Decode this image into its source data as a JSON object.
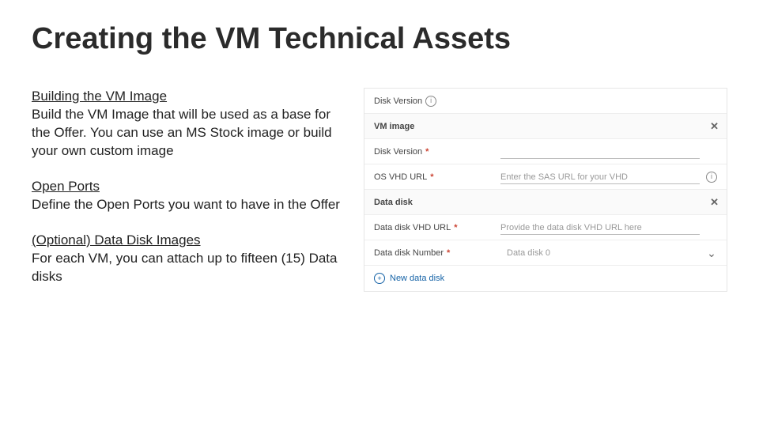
{
  "title": "Creating the VM Technical Assets",
  "sections": [
    {
      "heading": "Building the VM Image",
      "body": "Build the VM Image that will be used as a base for the Offer. You can use an MS Stock image or build your own custom image"
    },
    {
      "heading": "Open Ports",
      "body": "Define the Open Ports you want to have in the Offer"
    },
    {
      "heading": "(Optional) Data Disk Images",
      "body": "For each VM, you can attach up to fifteen (15) Data disks"
    }
  ],
  "form": {
    "row_disk_version_top": "Disk Version",
    "row_vm_image": "VM image",
    "row_disk_version": {
      "label": "Disk Version",
      "required": "*"
    },
    "row_os_vhd": {
      "label": "OS VHD URL",
      "required": "*",
      "placeholder": "Enter the SAS URL for your VHD"
    },
    "row_data_disk_hdr": "Data disk",
    "row_dd_vhd": {
      "label": "Data disk VHD URL",
      "required": "*",
      "placeholder": "Provide the data disk VHD URL here"
    },
    "row_dd_num": {
      "label": "Data disk Number",
      "required": "*",
      "value": "Data disk 0"
    },
    "row_new": "New data disk"
  }
}
